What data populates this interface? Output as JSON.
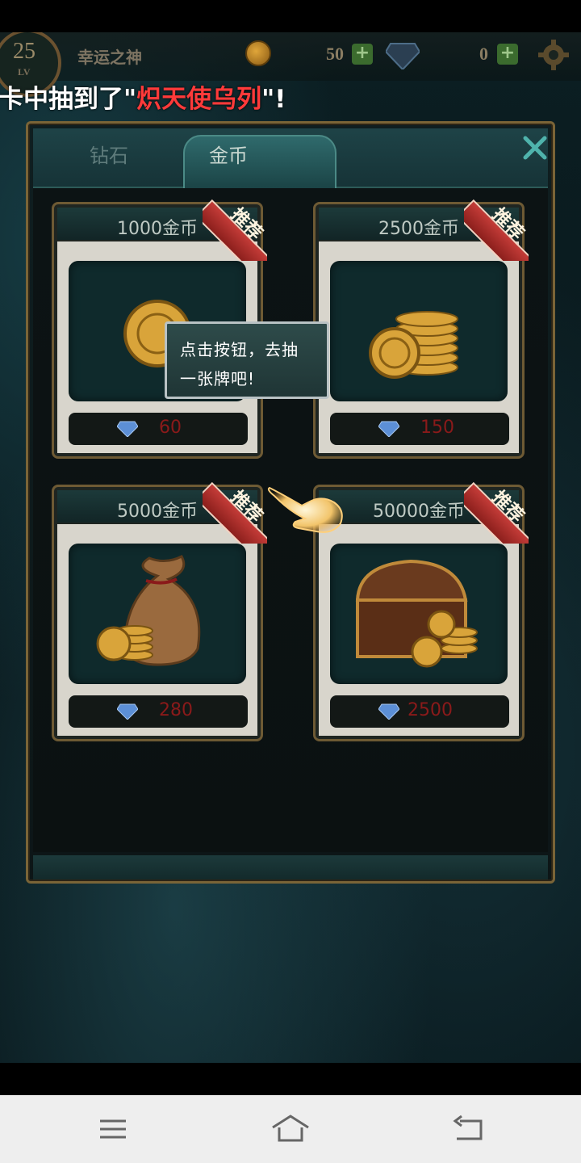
{
  "hud": {
    "level": "25",
    "level_label": "LV",
    "player_name": "幸运之神",
    "gold": "50",
    "gems": "0",
    "plus": "+"
  },
  "notice": {
    "prefix": "卡中抽到了\"",
    "highlight": "炽天使乌列",
    "suffix": "\"!"
  },
  "shop": {
    "tabs": [
      {
        "label": "钻石",
        "active": false
      },
      {
        "label": "金币",
        "active": true
      }
    ],
    "ribbon_label": "推荐",
    "items": [
      {
        "title": "1000金币",
        "price": "60",
        "image": "coin-stack-small"
      },
      {
        "title": "2500金币",
        "price": "150",
        "image": "coin-stack"
      },
      {
        "title": "5000金币",
        "price": "280",
        "image": "coin-bag"
      },
      {
        "title": "50000金币",
        "price": "2500",
        "image": "treasure-chest"
      }
    ]
  },
  "tooltip": {
    "line1": "点击按钮，去抽",
    "line2": "一张牌吧!"
  },
  "colors": {
    "accent_gold": "#7a6437",
    "price_red": "#8a1a1a",
    "highlight_red": "#ff3a3a"
  },
  "icons": [
    "gear-icon",
    "gem-icon",
    "coin-icon",
    "close-icon",
    "pointing-hand-icon",
    "menu-icon",
    "home-icon",
    "back-icon"
  ]
}
